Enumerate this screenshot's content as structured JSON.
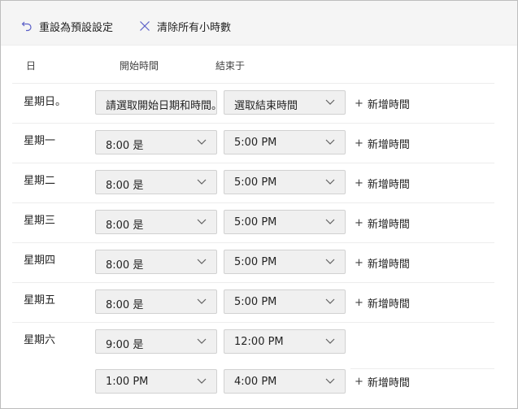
{
  "toolbar": {
    "reset_label": "重設為預設設定",
    "clear_label": "清除所有小時數"
  },
  "headers": {
    "day": "日",
    "start": "開始時間",
    "end": "結束于"
  },
  "add_time_label": "新增時間",
  "days": [
    {
      "label": "星期日。",
      "start": "請選取開始日期和時間。",
      "end": "選取結束時間"
    },
    {
      "label": "星期一",
      "start": "8:00 是",
      "end": "5:00 PM"
    },
    {
      "label": "星期二",
      "start": "8:00 是",
      "end": "5:00 PM"
    },
    {
      "label": "星期三",
      "start": "8:00 是",
      "end": "5:00 PM"
    },
    {
      "label": "星期四",
      "start": "8:00 是",
      "end": "5:00 PM"
    },
    {
      "label": "星期五",
      "start": "8:00 是",
      "end": "5:00 PM"
    },
    {
      "label": "星期六",
      "start": "9:00 是",
      "end": "12:00 PM",
      "start2": "1:00 PM",
      "end2": "4:00 PM"
    }
  ],
  "colors": {
    "dropdown_bg": "#f0f0f0",
    "toolbar_bg": "#f5f5f5",
    "icon_accent": "#5b5fc7"
  }
}
